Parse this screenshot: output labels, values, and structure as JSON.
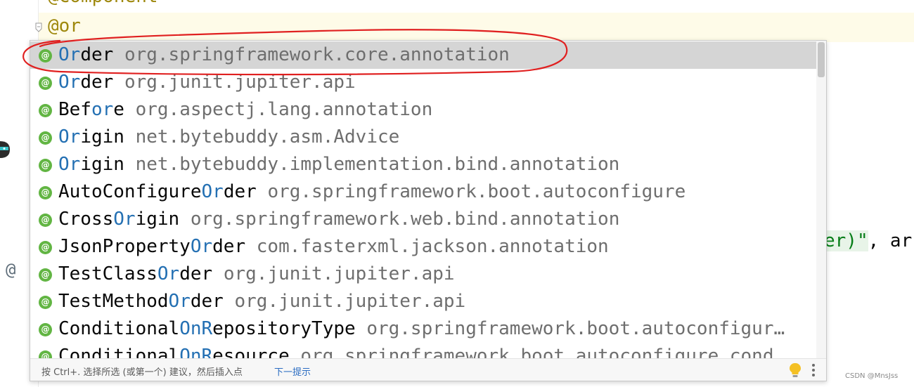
{
  "editor": {
    "prev_line_text": "@Component",
    "current_line_text": "@or",
    "gutter_symbol": "@",
    "right_code": {
      "string_part": "er)\"",
      "rest": ", ar"
    },
    "bottom_code_fragment": "        (         )     (          )       (  )  ",
    "colors": {
      "annotation": "#9e880d",
      "current_line_bg": "#fefbe8",
      "string": "#067d17"
    }
  },
  "completion": {
    "items": [
      {
        "pre": "",
        "match": "Or",
        "post": "der",
        "package": "org.springframework.core.annotation",
        "selected": true
      },
      {
        "pre": "",
        "match": "Or",
        "post": "der",
        "package": "org.junit.jupiter.api",
        "selected": false
      },
      {
        "pre": "Bef",
        "match": "or",
        "post": "e",
        "package": "org.aspectj.lang.annotation",
        "selected": false
      },
      {
        "pre": "",
        "match": "Or",
        "post": "igin",
        "package": "net.bytebuddy.asm.Advice",
        "selected": false
      },
      {
        "pre": "",
        "match": "Or",
        "post": "igin",
        "package": "net.bytebuddy.implementation.bind.annotation",
        "selected": false
      },
      {
        "pre": "AutoConfigure",
        "match": "Or",
        "post": "der",
        "package": "org.springframework.boot.autoconfigure",
        "selected": false
      },
      {
        "pre": "Cross",
        "match": "Or",
        "post": "igin",
        "package": "org.springframework.web.bind.annotation",
        "selected": false
      },
      {
        "pre": "JsonProperty",
        "match": "Or",
        "post": "der",
        "package": "com.fasterxml.jackson.annotation",
        "selected": false
      },
      {
        "pre": "TestClass",
        "match": "Or",
        "post": "der",
        "package": "org.junit.jupiter.api",
        "selected": false
      },
      {
        "pre": "TestMethod",
        "match": "Or",
        "post": "der",
        "package": "org.junit.jupiter.api",
        "selected": false
      },
      {
        "pre": "Conditional",
        "match": "OnR",
        "post": "epositoryType",
        "package": "org.springframework.boot.autoconfigur…",
        "selected": false
      },
      {
        "pre": "Conditional",
        "match": "OnR",
        "post": "esource",
        "package": "org.springframework.boot.autoconfigure.cond…",
        "selected": false
      }
    ],
    "badge_icon": "annotation-icon",
    "badge_symbol": "@",
    "footer": {
      "hint": "按 Ctrl+. 选择所选 (或第一个) 建议，然后插入点",
      "next_tip": "下一提示"
    },
    "colors": {
      "match": "#2470b3",
      "package": "#6e6e6e",
      "badge": "#62b543",
      "selected_bg": "#d5d5d5",
      "link": "#2a6cc2"
    }
  },
  "watermark": "CSDN @MnsJss"
}
